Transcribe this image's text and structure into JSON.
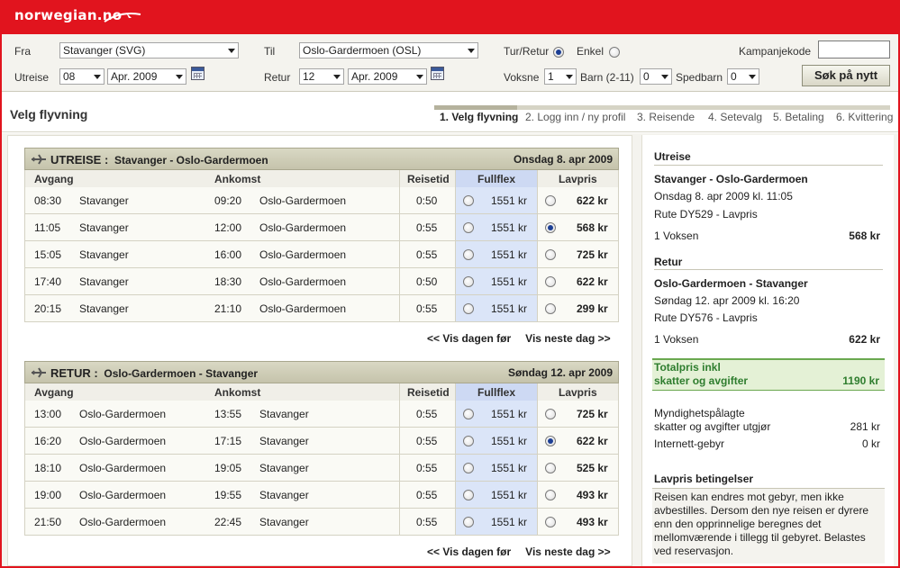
{
  "brand": {
    "logo": "norwegian.no",
    "red": "#e1141e"
  },
  "search": {
    "from_label": "Fra",
    "from_value": "Stavanger (SVG)",
    "to_label": "Til",
    "to_value": "Oslo-Gardermoen (OSL)",
    "roundtrip_label": "Tur/Retur",
    "oneway_label": "Enkel",
    "campaign_label": "Kampanjekode",
    "campaign_value": "",
    "outbound_label": "Utreise",
    "outbound_day": "08",
    "outbound_month": "Apr. 2009",
    "return_label": "Retur",
    "return_day": "12",
    "return_month": "Apr. 2009",
    "adults_label": "Voksne",
    "adults_value": "1",
    "children_label": "Barn (2-11)",
    "children_value": "0",
    "infants_label": "Spedbarn",
    "infants_value": "0",
    "search_button": "Søk på nytt"
  },
  "page": {
    "title": "Velg flyvning",
    "steps": [
      "1. Velg flyvning",
      "2. Logg inn / ny profil",
      "3. Reisende",
      "4. Setevalg",
      "5. Betaling",
      "6. Kvittering"
    ]
  },
  "columns": {
    "depart": "Avgang",
    "arrive": "Ankomst",
    "duration": "Reisetid",
    "fullflex": "Fullflex",
    "lowfare": "Lavpris"
  },
  "outbound": {
    "heading": "UTREISE :",
    "route": "Stavanger - Oslo-Gardermoen",
    "date": "Onsdag 8. apr 2009",
    "rows": [
      {
        "dep": "08:30",
        "from": "Stavanger",
        "arr": "09:20",
        "to": "Oslo-Gardermoen",
        "dur": "0:50",
        "flex": "1551 kr",
        "low": "622 kr",
        "selected": false
      },
      {
        "dep": "11:05",
        "from": "Stavanger",
        "arr": "12:00",
        "to": "Oslo-Gardermoen",
        "dur": "0:55",
        "flex": "1551 kr",
        "low": "568 kr",
        "selected": true
      },
      {
        "dep": "15:05",
        "from": "Stavanger",
        "arr": "16:00",
        "to": "Oslo-Gardermoen",
        "dur": "0:55",
        "flex": "1551 kr",
        "low": "725 kr",
        "selected": false
      },
      {
        "dep": "17:40",
        "from": "Stavanger",
        "arr": "18:30",
        "to": "Oslo-Gardermoen",
        "dur": "0:50",
        "flex": "1551 kr",
        "low": "622 kr",
        "selected": false
      },
      {
        "dep": "20:15",
        "from": "Stavanger",
        "arr": "21:10",
        "to": "Oslo-Gardermoen",
        "dur": "0:55",
        "flex": "1551 kr",
        "low": "299 kr",
        "selected": false
      }
    ],
    "prev": "<< Vis dagen før",
    "next": "Vis neste dag >>"
  },
  "return": {
    "heading": "RETUR :",
    "route": "Oslo-Gardermoen - Stavanger",
    "date": "Søndag 12. apr 2009",
    "rows": [
      {
        "dep": "13:00",
        "from": "Oslo-Gardermoen",
        "arr": "13:55",
        "to": "Stavanger",
        "dur": "0:55",
        "flex": "1551 kr",
        "low": "725 kr",
        "selected": false
      },
      {
        "dep": "16:20",
        "from": "Oslo-Gardermoen",
        "arr": "17:15",
        "to": "Stavanger",
        "dur": "0:55",
        "flex": "1551 kr",
        "low": "622 kr",
        "selected": true
      },
      {
        "dep": "18:10",
        "from": "Oslo-Gardermoen",
        "arr": "19:05",
        "to": "Stavanger",
        "dur": "0:55",
        "flex": "1551 kr",
        "low": "525 kr",
        "selected": false
      },
      {
        "dep": "19:00",
        "from": "Oslo-Gardermoen",
        "arr": "19:55",
        "to": "Stavanger",
        "dur": "0:55",
        "flex": "1551 kr",
        "low": "493 kr",
        "selected": false
      },
      {
        "dep": "21:50",
        "from": "Oslo-Gardermoen",
        "arr": "22:45",
        "to": "Stavanger",
        "dur": "0:55",
        "flex": "1551 kr",
        "low": "493 kr",
        "selected": false
      }
    ],
    "prev": "<< Vis dagen før",
    "next": "Vis neste dag >>"
  },
  "summary": {
    "out_heading": "Utreise",
    "out_route": "Stavanger - Oslo-Gardermoen",
    "out_when": "Onsdag 8. apr 2009 kl. 11:05",
    "out_flight": "Rute DY529 - Lavpris",
    "out_pax": "1 Voksen",
    "out_price": "568 kr",
    "ret_heading": "Retur",
    "ret_route": "Oslo-Gardermoen - Stavanger",
    "ret_when": "Søndag 12. apr 2009 kl. 16:20",
    "ret_flight": "Rute DY576 - Lavpris",
    "ret_pax": "1 Voksen",
    "ret_price": "622 kr",
    "total_line1": "Totalpris inkl",
    "total_line2": "skatter og avgifter",
    "total_value": "1190 kr",
    "tax_line1": "Myndighetspålagte",
    "tax_line2": "skatter og avgifter utgjør",
    "tax_value": "281 kr",
    "fee_label": "Internett-gebyr",
    "fee_value": "0 kr",
    "cond_heading": "Lavpris betingelser",
    "cond_text": "Reisen kan endres mot gebyr, men ikke avbestilles. Dersom den nye reisen er dyrere enn den opprinnelige beregnes det mellomværende i tillegg til gebyret. Belastes ved reservasjon."
  }
}
